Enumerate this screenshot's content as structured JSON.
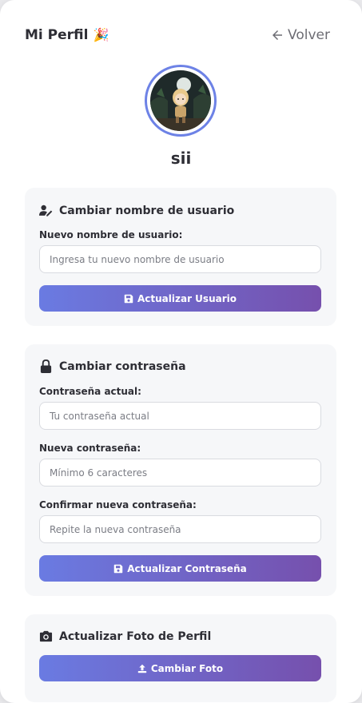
{
  "header": {
    "title": "Mi Perfil",
    "party_emoji": "🎉",
    "back_label": "Volver"
  },
  "profile": {
    "username": "sii"
  },
  "username_section": {
    "title": "Cambiar nombre de usuario",
    "field_label": "Nuevo nombre de usuario:",
    "field_placeholder": "Ingresa tu nuevo nombre de usuario",
    "button_label": "Actualizar Usuario"
  },
  "password_section": {
    "title": "Cambiar contraseña",
    "current_label": "Contraseña actual:",
    "current_placeholder": "Tu contraseña actual",
    "new_label": "Nueva contraseña:",
    "new_placeholder": "Mínimo 6 caracteres",
    "confirm_label": "Confirmar nueva contraseña:",
    "confirm_placeholder": "Repite la nueva contraseña",
    "button_label": "Actualizar Contraseña"
  },
  "photo_section": {
    "title": "Actualizar Foto de Perfil",
    "button_label": "Cambiar Foto"
  },
  "colors": {
    "accent_start": "#6a7be2",
    "accent_end": "#7650ad",
    "avatar_ring": "#6d82e6"
  }
}
